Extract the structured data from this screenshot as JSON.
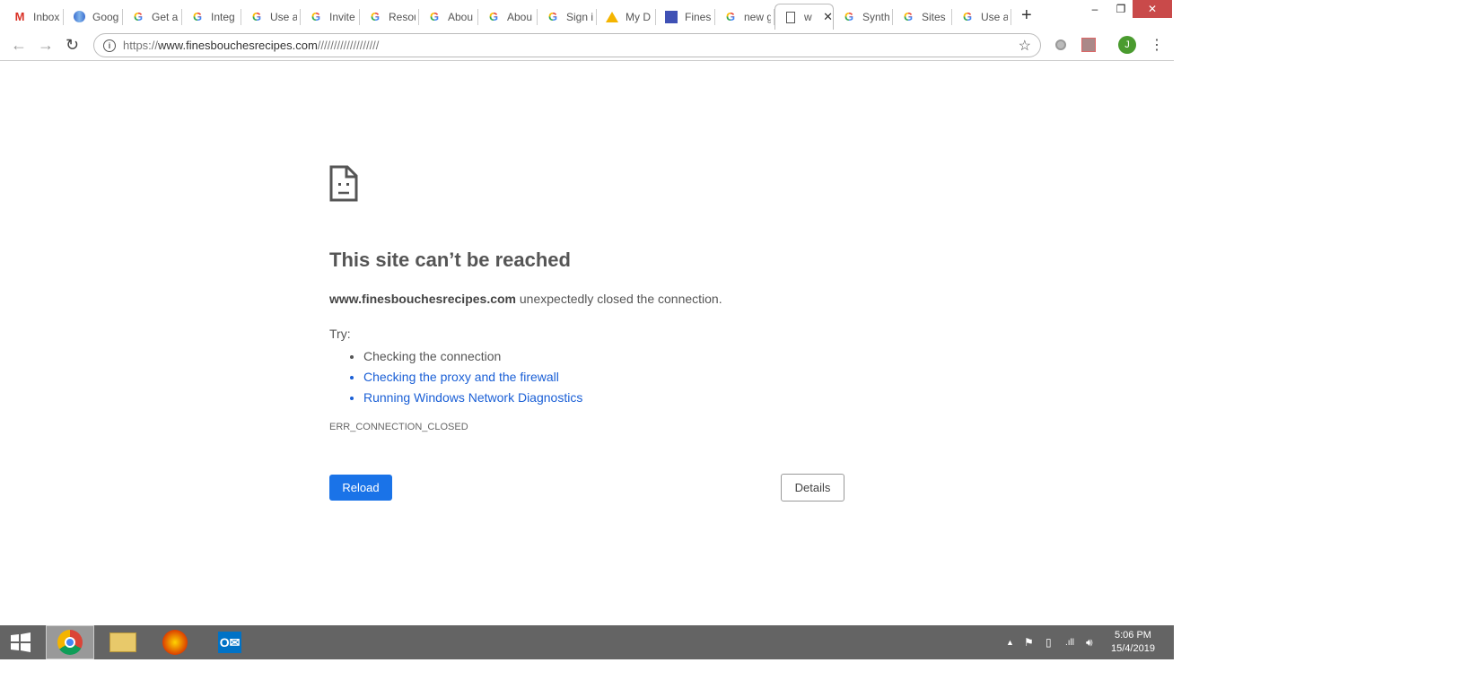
{
  "tabs": [
    {
      "label": "Inbox",
      "icon": "gmail-icon"
    },
    {
      "label": "Goog",
      "icon": "globe-icon"
    },
    {
      "label": "Get a",
      "icon": "google-icon"
    },
    {
      "label": "Integ",
      "icon": "google-icon"
    },
    {
      "label": "Use a",
      "icon": "google-icon"
    },
    {
      "label": "Invite",
      "icon": "google-icon"
    },
    {
      "label": "Resou",
      "icon": "google-icon"
    },
    {
      "label": "Abou",
      "icon": "google-icon"
    },
    {
      "label": "Abou",
      "icon": "google-icon"
    },
    {
      "label": "Sign i",
      "icon": "google-icon"
    },
    {
      "label": "My D",
      "icon": "drive-icon"
    },
    {
      "label": "Fines",
      "icon": "sites-icon"
    },
    {
      "label": "new g",
      "icon": "google-icon"
    },
    {
      "label": "w",
      "icon": "page-icon",
      "active": true
    },
    {
      "label": "Synth",
      "icon": "google-icon"
    },
    {
      "label": "Sites",
      "icon": "google-icon"
    },
    {
      "label": "Use a",
      "icon": "google-icon"
    }
  ],
  "window": {
    "minimize": "–",
    "restore": "❐",
    "close": "✕"
  },
  "omnibox": {
    "scheme": "https://",
    "host": "www.finesbouchesrecipes.com",
    "path": "///////////////////"
  },
  "profile_initial": "J",
  "error": {
    "title": "This site can’t be reached",
    "host": "www.finesbouchesrecipes.com",
    "message": " unexpectedly closed the connection.",
    "try_label": "Try:",
    "suggestions": [
      "Checking the connection",
      "Checking the proxy and the firewall",
      "Running Windows Network Diagnostics"
    ],
    "code": "ERR_CONNECTION_CLOSED",
    "reload": "Reload",
    "details": "Details"
  },
  "clock": {
    "time": "5:06 PM",
    "date": "15/4/2019"
  },
  "colors": {
    "accent": "#1a73e8",
    "taskbar": "#646464",
    "close": "#c94a4a"
  }
}
